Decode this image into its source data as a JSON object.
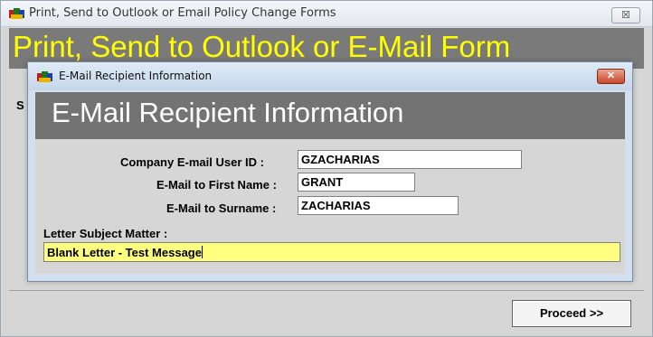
{
  "main_window": {
    "title": "Print, Send to Outlook or Email Policy Change Forms",
    "close_label": "☒",
    "heading": "Print, Send to Outlook or E-Mail Form",
    "partial_label": "S",
    "proceed_label": "Proceed >>"
  },
  "dialog": {
    "title": "E-Mail Recipient Information",
    "close_label": "✕",
    "heading": "E-Mail Recipient Information",
    "fields": {
      "user_id_label": "Company E-mail User ID :",
      "user_id_value": "GZACHARIAS",
      "first_name_label": "E-Mail to First Name :",
      "first_name_value": "GRANT",
      "surname_label": "E-Mail to Surname :",
      "surname_value": "ZACHARIAS",
      "subject_label": "Letter Subject Matter :",
      "subject_value": "Blank Letter - Test Message"
    }
  },
  "colors": {
    "band_gray": "#737373",
    "heading_yellow": "#ffff00",
    "subject_bg": "#ffff80",
    "close_red": "#c9472b"
  },
  "icons": [
    "app-icon",
    "close-icon",
    "dialog-app-icon",
    "dialog-close-icon"
  ]
}
